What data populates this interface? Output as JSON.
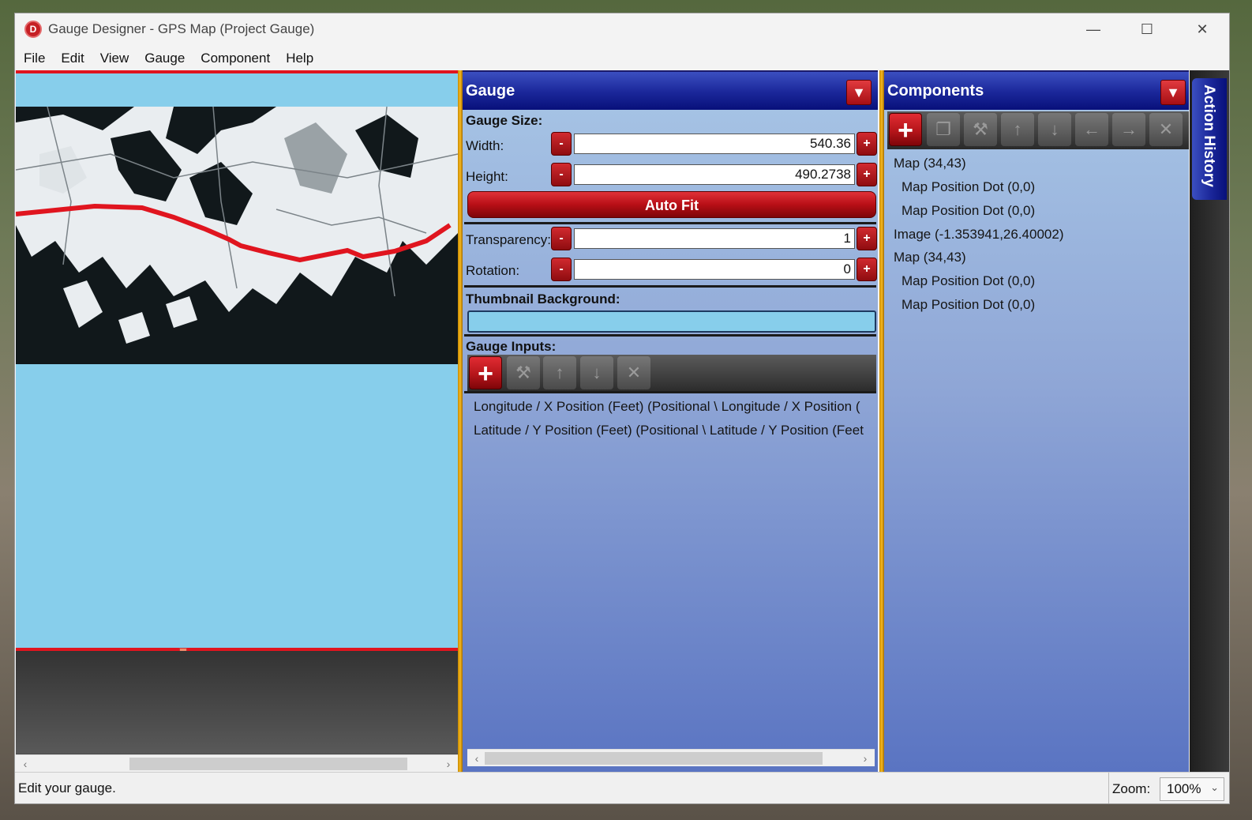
{
  "window": {
    "title": "Gauge Designer - GPS Map (Project Gauge)",
    "logo_letter": "D",
    "controls": {
      "minimize": "—",
      "maximize": "☐",
      "close": "✕"
    }
  },
  "menu": [
    "File",
    "Edit",
    "View",
    "Gauge",
    "Component",
    "Help"
  ],
  "gauge_panel": {
    "title": "Gauge",
    "pin": "📌",
    "size_label": "Gauge Size:",
    "width_label": "Width:",
    "width_value": "540.36",
    "height_label": "Height:",
    "height_value": "490.2738",
    "autofit_label": "Auto Fit",
    "transparency_label": "Transparency:",
    "transparency_value": "1",
    "rotation_label": "Rotation:",
    "rotation_value": "0",
    "thumbnail_label": "Thumbnail Background:",
    "thumbnail_color": "#87ceeb",
    "inputs_label": "Gauge Inputs:",
    "inputs": [
      "Longitude / X Position (Feet) (Positional \\ Longitude / X Position (",
      "Latitude / Y Position (Feet) (Positional \\ Latitude / Y Position (Feet"
    ],
    "minus": "-",
    "plus": "+"
  },
  "components_panel": {
    "title": "Components",
    "items": [
      "Map (34,43)",
      "Map Position Dot (0,0)",
      "Map Position Dot (0,0)",
      "Image (-1.353941,26.40002)",
      "Map (34,43)",
      "Map Position Dot (0,0)",
      "Map Position Dot (0,0)"
    ]
  },
  "action_history": {
    "label": "Action History"
  },
  "status": {
    "text": "Edit your gauge.",
    "zoom_label": "Zoom:",
    "zoom_value": "100%"
  },
  "colors": {
    "accent_red": "#c51f24",
    "panel_blue": "#1a2699",
    "gauge_bg": "#87ceeb",
    "route_red": "#e0151f"
  }
}
